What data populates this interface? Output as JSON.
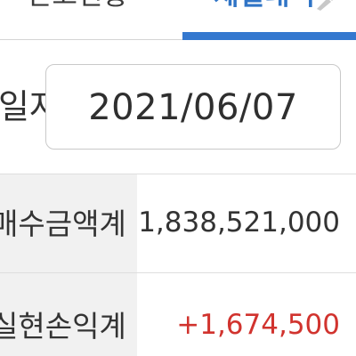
{
  "tabs": {
    "left_label": "잔고현황",
    "right_label": "체결내역",
    "right_icon": "pencil-icon",
    "active_color": "#3478cf"
  },
  "date_filter": {
    "label": "일자",
    "value": "2021/06/07"
  },
  "summary": {
    "rows": [
      {
        "label": "매수금액계",
        "value": "1,838,521,000",
        "color": "#333333"
      },
      {
        "label": "실현손익계",
        "value": "+1,674,500",
        "color": "#d1332e"
      }
    ]
  }
}
